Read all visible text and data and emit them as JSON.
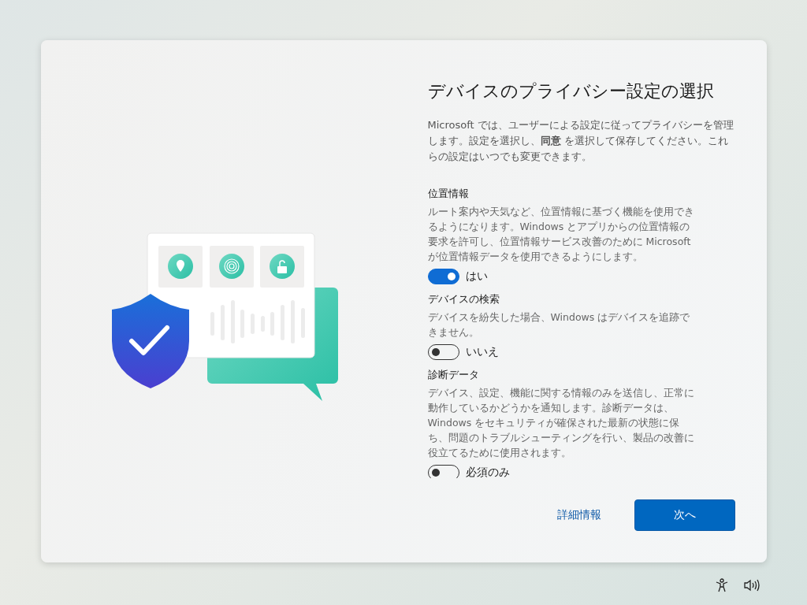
{
  "dialog": {
    "title": "デバイスのプライバシー設定の選択",
    "intro": "Microsoft では、ユーザーによる設定に従ってプライバシーを管理します。設定を選択し、**同意** を選択して保存してください。これらの設定はいつでも変更できます。"
  },
  "settings": [
    {
      "title": "位置情報",
      "description": "ルート案内や天気など、位置情報に基づく機能を使用できるようになります。Windows とアプリからの位置情報の要求を許可し、位置情報サービス改善のために Microsoft が位置情報データを使用できるようにします。",
      "on": true,
      "label": "はい"
    },
    {
      "title": "デバイスの検索",
      "description": "デバイスを紛失した場合、Windows はデバイスを追跡できません。",
      "on": false,
      "label": "いいえ"
    },
    {
      "title": "診断データ",
      "description": "デバイス、設定、機能に関する情報のみを送信し、正常に動作しているかどうかを通知します。診断データは、Windows をセキュリティが確保された最新の状態に保ち、問題のトラブルシューティングを行い、製品の改善に役立てるために使用されます。",
      "on": false,
      "label": "必須のみ"
    }
  ],
  "footer": {
    "link": "詳細情報",
    "button": "次へ"
  }
}
